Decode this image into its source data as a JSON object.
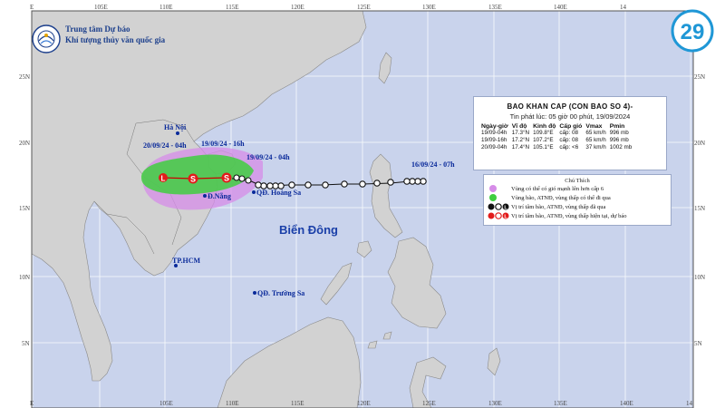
{
  "agency": {
    "line1": "Trung tâm Dự báo",
    "line2": "Khí tượng thủy văn quốc gia"
  },
  "brand": {
    "text": "29",
    "color": "#1f97d6",
    "icon": "29-brand-logo"
  },
  "colors": {
    "land": "#d2d2d2",
    "sea": "#c9d3ec",
    "grid": "#ffffff",
    "past_track": "#111111",
    "forecast_track": "#cc0000",
    "probable_area": "#d68ce8",
    "risk_area": "#3fce3f"
  },
  "lon_ticks": [
    "E",
    "105E",
    "110E",
    "115E",
    "120E",
    "125E",
    "130E",
    "135E",
    "140E",
    "14"
  ],
  "lat_ticks": [
    "25N",
    "20N",
    "15N",
    "10N",
    "5N"
  ],
  "top_lon_ticks": [
    "E",
    "105E",
    "110E",
    "115E",
    "120E",
    "125E",
    "130E",
    "135E",
    "140E",
    "14"
  ],
  "map_labels": {
    "ha_noi": "Hà Nội",
    "da_nang": "Đ.Nẵng",
    "hoang_sa": "QĐ. Hoàng Sa",
    "tp_hcm": "TP.HCM",
    "truong_sa": "QĐ. Trường Sa",
    "bien_dong": "Biển Đông"
  },
  "track_labels": {
    "t1": "20/09/24 - 04h",
    "t2": "19/09/24 - 16h",
    "t3": "19/09/24 - 04h",
    "t4": "16/09/24 - 07h"
  },
  "info": {
    "title": "BAO  KHAN CAP (CON BAO SO 4)-",
    "issued": "Tin phát lúc: 05 giờ 00 phút, 19/09/2024",
    "headers": [
      "Ngày-giờ",
      "Vĩ độ",
      "Kinh độ",
      "Cấp gió",
      "Vmax",
      "Pmin"
    ],
    "rows": [
      [
        "19/09-04h",
        "17.3°N",
        "109.8°E",
        "cấp: 08",
        "65 km/h",
        "996 mb"
      ],
      [
        "19/09-16h",
        "17.2°N",
        "107.2°E",
        "cấp: 08",
        "65 km/h",
        "996 mb"
      ],
      [
        "20/09-04h",
        "17.4°N",
        "105.1°E",
        "cấp: <6",
        "37 km/h",
        "1002 mb"
      ]
    ]
  },
  "legend": {
    "title": "Chú Thích",
    "items": [
      {
        "icon": "pink-circle-icon",
        "text": "Vùng có thể có gió mạnh lên hơn cấp 6"
      },
      {
        "icon": "green-circle-icon",
        "text": "Vùng bão, ATNĐ, vùng thấp có thể đi qua"
      },
      {
        "icon": "black-storm-symbols-icon",
        "text": "Vị trí tâm bão, ATNĐ, vùng thấp đã qua"
      },
      {
        "icon": "red-storm-symbols-icon",
        "text": "Vị trí tâm bão, ATNĐ, vùng thấp hiện tại, dự báo"
      }
    ]
  }
}
